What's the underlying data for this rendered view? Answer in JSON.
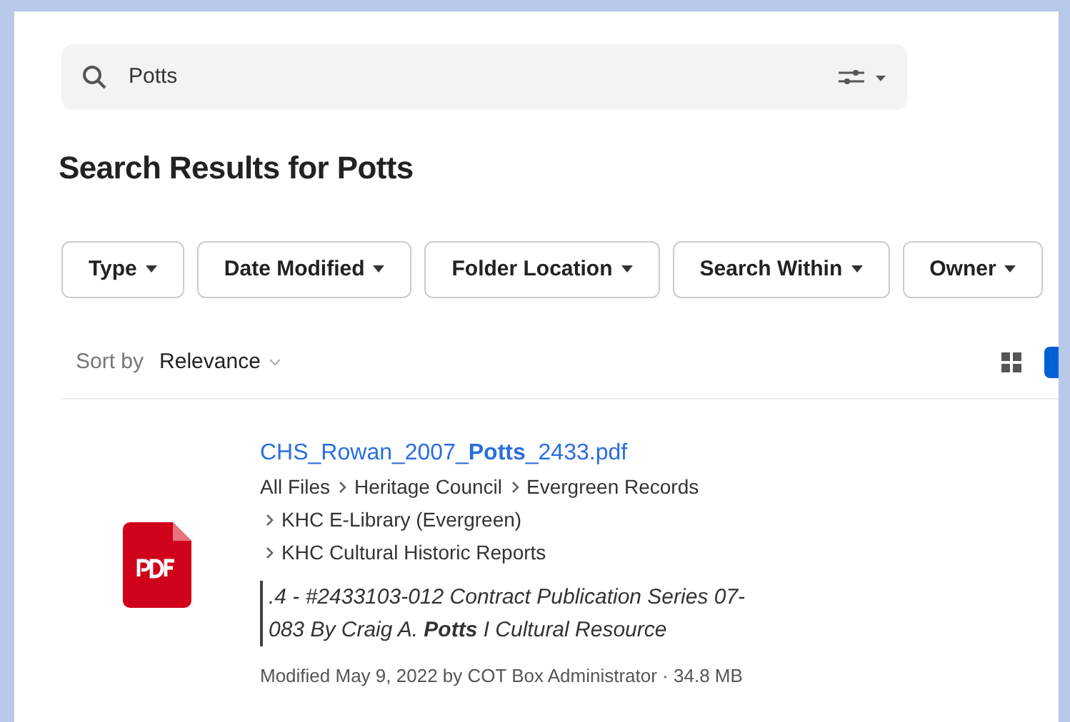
{
  "search": {
    "value": "Potts"
  },
  "title": "Search Results for Potts",
  "filters": [
    "Type",
    "Date Modified",
    "Folder Location",
    "Search Within",
    "Owner"
  ],
  "sort": {
    "label": "Sort by",
    "value": "Relevance"
  },
  "view_toggles": [
    {
      "kind": "grid",
      "selected": false
    },
    {
      "kind": "list",
      "selected": true
    }
  ],
  "results": [
    {
      "kind": "pdf",
      "name": "CHS_Rowan_2007_**Potts**_2433.pdf",
      "path_lines": [
        [
          "All Files",
          "Heritage Council",
          "Evergreen Records"
        ],
        [
          "KHC E-Library (Evergreen)"
        ],
        [
          "KHC Cultural Historic Reports"
        ]
      ],
      "snippet": ".4 - #2433103-012 Contract Publication Series 07-083 By Craig A. **Potts** I Cultural Resource",
      "meta": "Modified May 9, 2022 by COT Box Administrator · 34.8 MB"
    }
  ]
}
